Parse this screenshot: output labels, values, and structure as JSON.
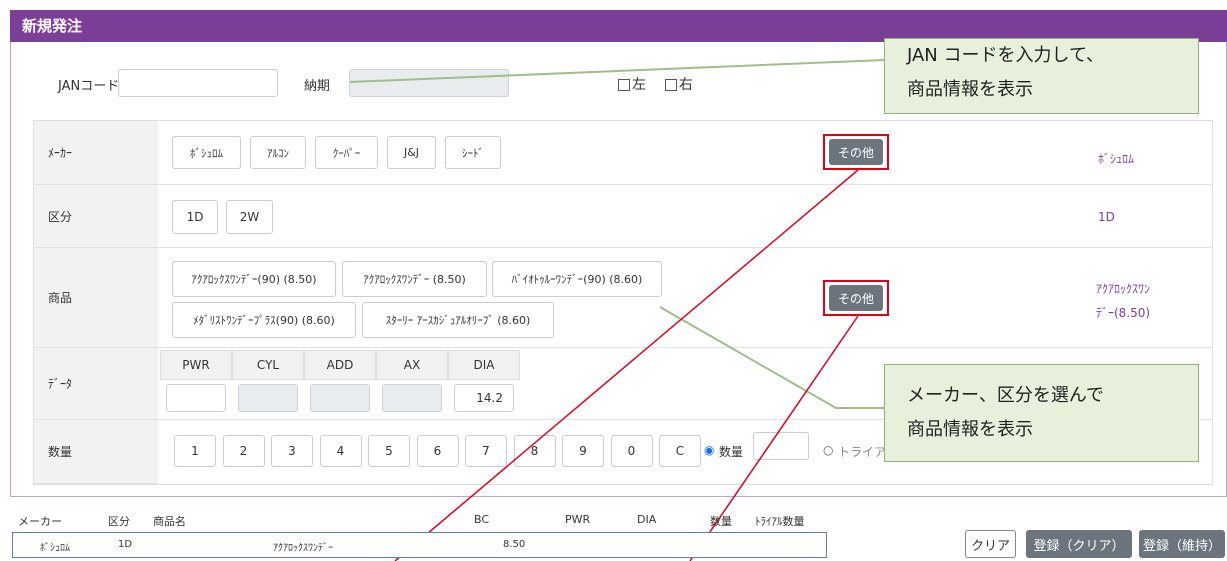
{
  "title": "新規発注",
  "jan": {
    "label": "JANコード",
    "value": ""
  },
  "nouki": {
    "label": "納期",
    "value": ""
  },
  "eyes": {
    "left": "左",
    "right": "右"
  },
  "callouts": {
    "top": [
      "JAN コードを入力して、",
      "商品情報を表示"
    ],
    "mid": [
      "メーカー、区分を選んで",
      "商品情報を表示"
    ]
  },
  "maker": {
    "label": "ﾒｰｶｰ",
    "buttons": [
      "ﾎﾞｼｭﾛﾑ",
      "ｱﾙｺﾝ",
      "ｸｰﾊﾟｰ",
      "J&J",
      "ｼｰﾄﾞ"
    ],
    "other": "その他",
    "selected": "ﾎﾞｼｭﾛﾑ"
  },
  "kubun": {
    "label": "区分",
    "buttons": [
      "1D",
      "2W"
    ],
    "selected": "1D"
  },
  "shohin": {
    "label": "商品",
    "buttons_row1": [
      "ｱｸｱﾛｯｸｽﾜﾝﾃﾞｰ(90) (8.50)",
      "ｱｸｱﾛｯｸｽﾜﾝﾃﾞｰ (8.50)",
      "ﾊﾞｲｵﾄｩﾙｰﾜﾝﾃﾞｰ(90) (8.60)"
    ],
    "buttons_row2": [
      "ﾒﾀﾞﾘｽﾄﾜﾝﾃﾞｰﾌﾟﾗｽ(90) (8.60)",
      "ｽﾀｰﾘｰ ｱｰｽｶｼﾞｭｱﾙｵﾘｰﾌﾞ (8.60)"
    ],
    "other": "その他",
    "selected_line1": "ｱｸｱﾛｯｸｽﾜﾝ",
    "selected_line2": "ﾃﾞｰ(8.50)"
  },
  "data": {
    "label": "ﾃﾞｰﾀ",
    "headers": [
      "PWR",
      "CYL",
      "ADD",
      "AX",
      "DIA"
    ],
    "dia_value": "14.2"
  },
  "suryo": {
    "label": "数量",
    "keys": [
      "1",
      "2",
      "3",
      "4",
      "5",
      "6",
      "7",
      "8",
      "9",
      "0",
      "C"
    ],
    "radio_qty": "数量",
    "radio_trial": "トライアル数量"
  },
  "list": {
    "headers": [
      "メーカー",
      "区分",
      "商品名",
      "BC",
      "PWR",
      "DIA",
      "数量",
      "ﾄﾗｲｱﾙ数量"
    ],
    "row": {
      "maker": "ﾎﾞｼｭﾛﾑ",
      "kubun": "1D",
      "name": "ｱｸｱﾛｯｸｽﾜﾝﾃﾞｰ",
      "bc": "8.50"
    }
  },
  "footer": {
    "clear": "クリア",
    "save_clear": "登録（クリア）",
    "save_keep": "登録（維持）"
  },
  "colors": {
    "brand": "#7b3f98",
    "highlight": "#e0001b",
    "callout_bg": "#e6f0da",
    "callout_border": "#8fb27a"
  }
}
